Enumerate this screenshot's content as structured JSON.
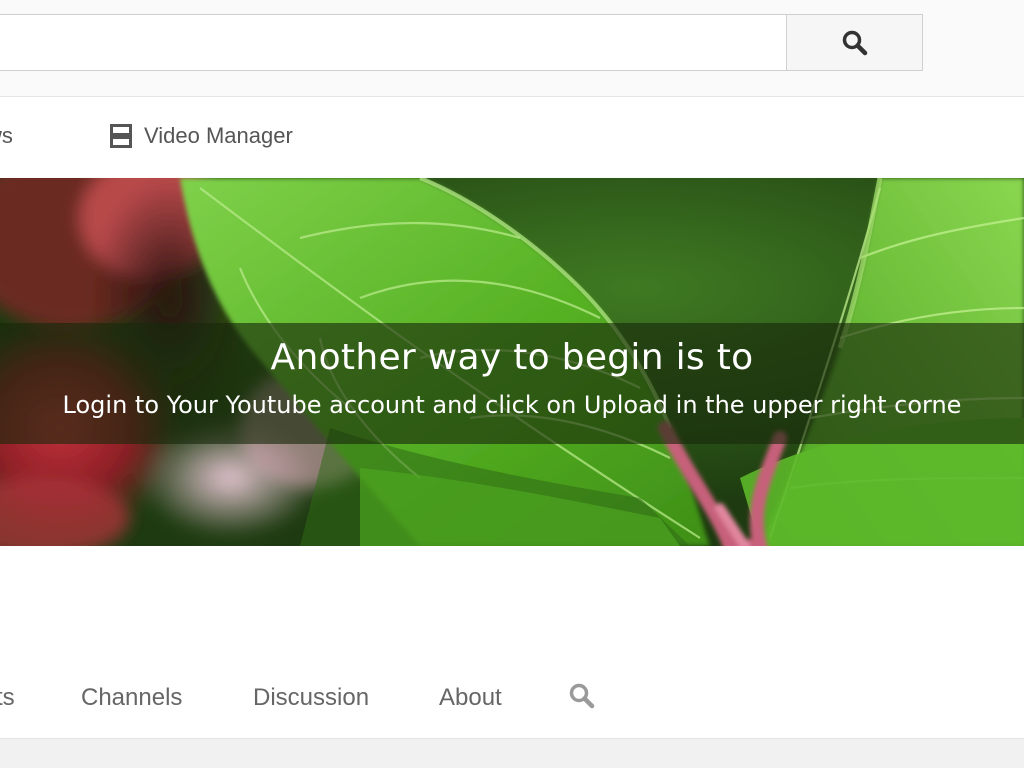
{
  "search": {
    "value": "",
    "placeholder": "",
    "button_icon": "search-icon"
  },
  "subnav": {
    "items": [
      {
        "label": "ws",
        "icon": ""
      },
      {
        "label": "Video Manager",
        "icon": "video-manager-icon"
      }
    ]
  },
  "banner": {
    "title": "Another way to begin is to",
    "subtitle": "Login to Your Youtube account and click on Upload in the upper right corne"
  },
  "tabs": {
    "items": [
      {
        "label": "ts"
      },
      {
        "label": "Channels"
      },
      {
        "label": "Discussion"
      },
      {
        "label": "About"
      }
    ],
    "search_icon": "search-icon"
  },
  "colors": {
    "overlay": "#18280c",
    "leaf_green": "#5fbf2a",
    "tab_text": "#666666",
    "nav_text": "#555555"
  }
}
